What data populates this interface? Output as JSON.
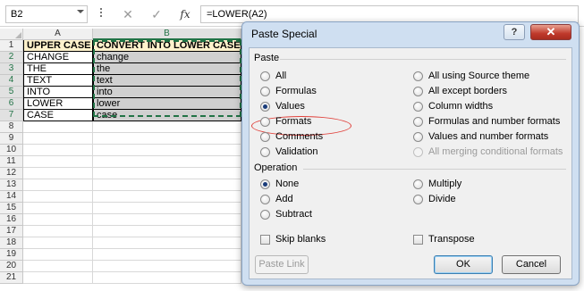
{
  "formula_bar": {
    "name_box": "B2",
    "cancel_glyph": "✕",
    "enter_glyph": "✓",
    "fx_label": "fx",
    "formula": "=LOWER(A2)"
  },
  "sheet": {
    "columns": [
      "A",
      "B"
    ],
    "row_numbers": [
      "1",
      "2",
      "3",
      "4",
      "5",
      "6",
      "7",
      "8",
      "9",
      "10",
      "11",
      "12",
      "13",
      "14",
      "15",
      "16",
      "17",
      "18",
      "19",
      "20",
      "21"
    ],
    "header_row": [
      "UPPER CASE",
      "CONVERT INTO LOWER CASE"
    ],
    "rows": [
      [
        "CHANGE",
        "change"
      ],
      [
        "THE",
        "the"
      ],
      [
        "TEXT",
        "text"
      ],
      [
        "INTO",
        "into"
      ],
      [
        "LOWER",
        "lower"
      ],
      [
        "CASE",
        "case"
      ]
    ],
    "header_fill": "#fff2cc",
    "selection_fill": "#d0d0d0",
    "marquee_color": "#217346"
  },
  "dialog": {
    "title": "Paste Special",
    "help_glyph": "?",
    "close_glyph": "✕",
    "paste_section": "Paste",
    "paste_left": [
      "All",
      "Formulas",
      "Values",
      "Formats",
      "Comments",
      "Validation"
    ],
    "paste_right": [
      "All using Source theme",
      "All except borders",
      "Column widths",
      "Formulas and number formats",
      "Values and number formats",
      "All merging conditional formats"
    ],
    "paste_selected": "Values",
    "operation_section": "Operation",
    "operation_left": [
      "None",
      "Add",
      "Subtract"
    ],
    "operation_right": [
      "Multiply",
      "Divide"
    ],
    "operation_selected": "None",
    "skip_blanks": "Skip blanks",
    "transpose": "Transpose",
    "paste_link_button": "Paste Link",
    "ok_button": "OK",
    "cancel_button": "Cancel",
    "highlight_color": "#e0403a"
  }
}
